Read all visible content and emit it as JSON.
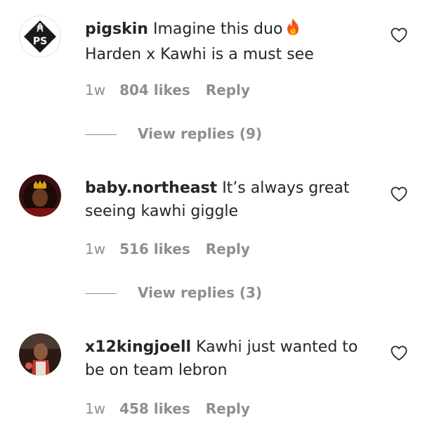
{
  "comments": [
    {
      "username": "pigskin",
      "text_line1": " Imagine this duo",
      "emoji": "fire-emoji",
      "text_line2": "Harden x Kawhi is a must see",
      "time": "1w",
      "likes": "804 likes",
      "reply": "Reply",
      "view_replies": "View replies (9)",
      "avatar": "pigskin-logo"
    },
    {
      "username": "baby.northeast",
      "text_line1": " It’s always great",
      "text_line2": "seeing kawhi giggle",
      "time": "1w",
      "likes": "516 likes",
      "reply": "Reply",
      "view_replies": "View replies (3)",
      "avatar": "user-photo"
    },
    {
      "username": "x12kingjoell",
      "text_line1": " Kawhi just wanted to",
      "text_line2": "be on team lebron",
      "time": "1w",
      "likes": "458 likes",
      "reply": "Reply",
      "avatar": "user-photo"
    }
  ],
  "colors": {
    "text": "#262626",
    "secondary": "#8e8e8e"
  }
}
